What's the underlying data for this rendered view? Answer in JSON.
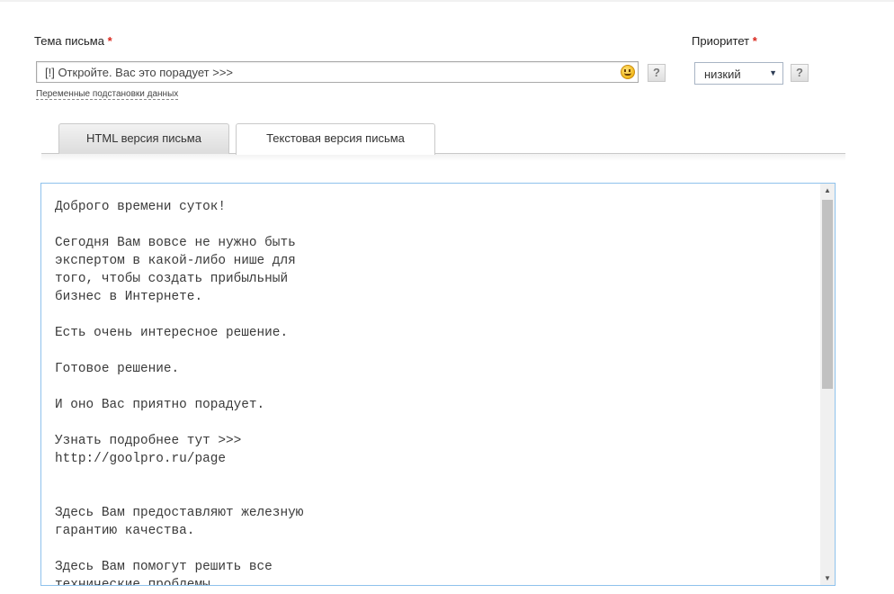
{
  "subject": {
    "label": "Тема письма",
    "required_mark": "*",
    "value": "[!] Откройте. Вас это порадует >>>",
    "emoji_icon": "smiley-icon",
    "help_label": "?",
    "variables_link": "Переменные подстановки данных"
  },
  "priority": {
    "label": "Приоритет",
    "required_mark": "*",
    "selected": "низкий",
    "help_label": "?"
  },
  "tabs": [
    {
      "label": "HTML версия письма",
      "active": false
    },
    {
      "label": "Текстовая версия письма",
      "active": true
    }
  ],
  "text_body": "Доброго времени суток!\n\nСегодня Вам вовсе не нужно быть\nэкспертом в какой-либо нише для\nтого, чтобы создать прибыльный\nбизнес в Интернете.\n\nЕсть очень интересное решение.\n\nГотовое решение.\n\nИ оно Вас приятно порадует.\n\nУзнать подробнее тут >>>\nhttp://goolpro.ru/page\n\n\nЗдесь Вам предоставляют железную\nгарантию качества.\n\nЗдесь Вам помогут решить все\nтехнические проблемы",
  "colors": {
    "required": "#d9261c",
    "textarea_border": "#8fc2ec",
    "select_border": "#a8b4c4"
  }
}
